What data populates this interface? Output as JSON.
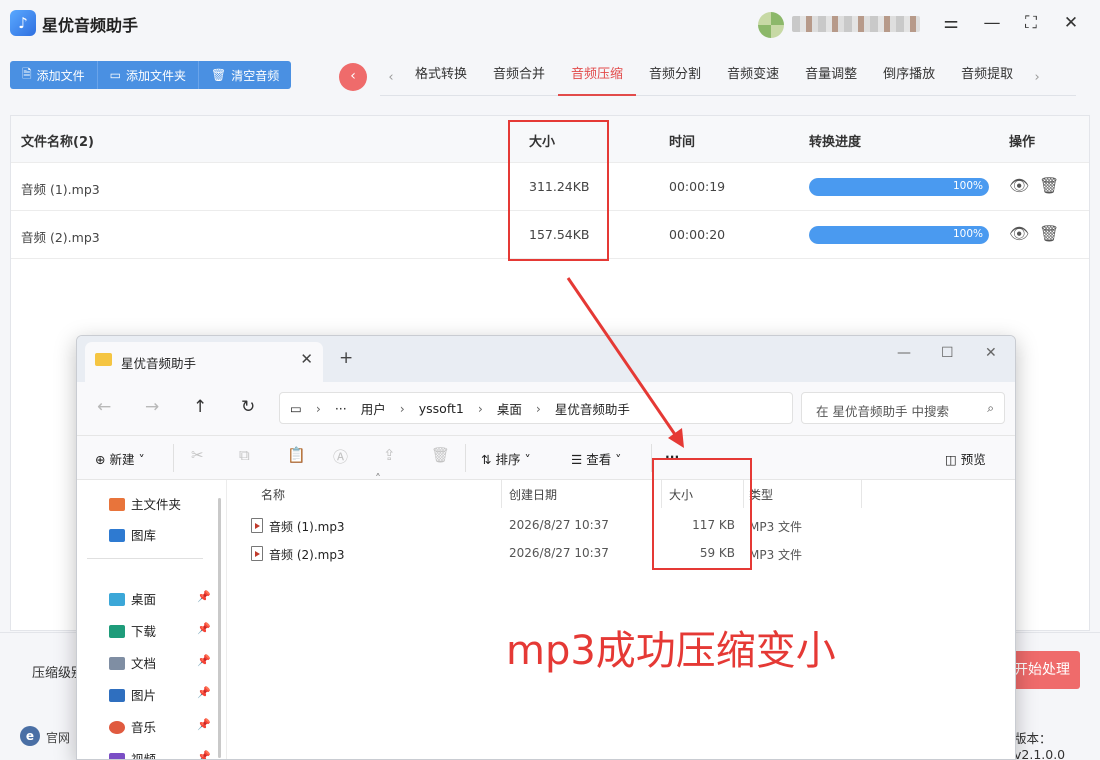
{
  "app": {
    "title": "星优音频助手",
    "window_controls": [
      "☰",
      "—",
      "⛶",
      "✕"
    ]
  },
  "toolbar": {
    "buttons": [
      {
        "icon": "file-icon",
        "label": "添加文件"
      },
      {
        "icon": "folder-icon",
        "label": "添加文件夹"
      },
      {
        "icon": "trash-icon",
        "label": "清空音频"
      }
    ]
  },
  "tabs": {
    "items": [
      "格式转换",
      "音频合并",
      "音频压缩",
      "音频分割",
      "音频变速",
      "音量调整",
      "倒序播放",
      "音频提取"
    ],
    "active": "音频压缩"
  },
  "table": {
    "headers": {
      "name": "文件名称(2)",
      "size": "大小",
      "time": "时间",
      "progress": "转换进度",
      "action": "操作"
    },
    "rows": [
      {
        "name": "音频 (1).mp3",
        "size": "311.24KB",
        "time": "00:00:19",
        "progress": 1.0,
        "progress_label": "100%"
      },
      {
        "name": "音频 (2).mp3",
        "size": "157.54KB",
        "time": "00:00:20",
        "progress": 1.0,
        "progress_label": "100%"
      }
    ]
  },
  "bottom": {
    "compress_label": "压缩级别",
    "start_label": "开始处理",
    "site_label": "官网",
    "version": "版本：v2.1.0.0"
  },
  "explorer": {
    "tab_title": "星优音频助手",
    "breadcrumb": [
      "用户",
      "yssoft1",
      "桌面",
      "星优音频助手"
    ],
    "search_placeholder": "在 星优音频助手 中搜索",
    "cmd": {
      "new": "新建",
      "sort": "排序",
      "view": "查看",
      "more": "···",
      "preview": "预览"
    },
    "sidebar": [
      {
        "label": "主文件夹",
        "icon": "home-icon",
        "pinned": false
      },
      {
        "label": "图库",
        "icon": "gallery-icon",
        "pinned": false
      },
      {
        "label": "桌面",
        "icon": "desktop-icon",
        "pinned": true
      },
      {
        "label": "下载",
        "icon": "download-icon",
        "pinned": true
      },
      {
        "label": "文档",
        "icon": "document-icon",
        "pinned": true
      },
      {
        "label": "图片",
        "icon": "picture-icon",
        "pinned": true
      },
      {
        "label": "音乐",
        "icon": "music-icon",
        "pinned": true
      },
      {
        "label": "视频",
        "icon": "video-icon",
        "pinned": true
      }
    ],
    "columns": {
      "name": "名称",
      "date": "创建日期",
      "size": "大小",
      "type": "类型"
    },
    "files": [
      {
        "name": "音频 (1).mp3",
        "date": "2026/8/27 10:37",
        "size": "117 KB",
        "type": "MP3 文件"
      },
      {
        "name": "音频 (2).mp3",
        "date": "2026/8/27 10:37",
        "size": "59 KB",
        "type": "MP3 文件"
      }
    ]
  },
  "annotation": {
    "caption": "mp3成功压缩变小",
    "color": "#e53935"
  }
}
